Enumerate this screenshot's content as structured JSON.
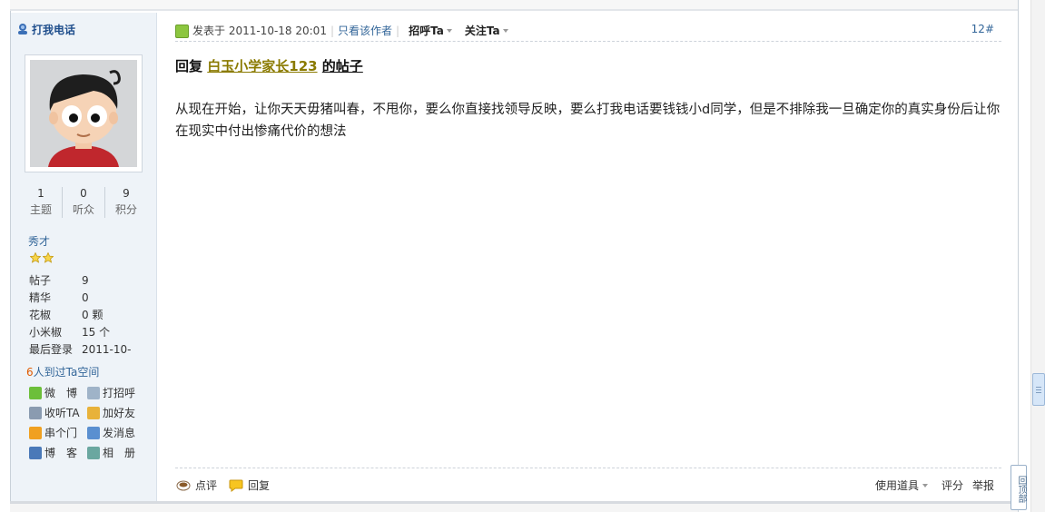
{
  "sidebar": {
    "call_me": "打我电话",
    "stats": [
      {
        "value": "1",
        "label": "主题"
      },
      {
        "value": "0",
        "label": "听众"
      },
      {
        "value": "9",
        "label": "积分"
      }
    ],
    "rank": "秀才",
    "star_count": 2,
    "info": [
      {
        "key": "帖子",
        "value": "9"
      },
      {
        "key": "精华",
        "value": "0"
      },
      {
        "key": "花椒",
        "value": "0 颗"
      },
      {
        "key": "小米椒",
        "value": "15 个"
      },
      {
        "key": "最后登录",
        "value": "2011-10-"
      }
    ],
    "visitors_count": "6",
    "visitors_text": "人到过Ta空间",
    "actions": [
      {
        "label": "微　博",
        "icon": "weibo-icon"
      },
      {
        "label": "打招呼",
        "icon": "greet-icon"
      },
      {
        "label": "收听TA",
        "icon": "follow-icon"
      },
      {
        "label": "加好友",
        "icon": "add-friend-icon"
      },
      {
        "label": "串个门",
        "icon": "home-icon"
      },
      {
        "label": "发消息",
        "icon": "message-icon"
      },
      {
        "label": "博　客",
        "icon": "blog-icon"
      },
      {
        "label": "相　册",
        "icon": "album-icon"
      }
    ]
  },
  "post": {
    "posted_label": "发表于 2011-10-18 20:01",
    "author_only": "只看该作者",
    "greet_dropdown": "招呼Ta",
    "follow_dropdown": "关注Ta",
    "floor": "12#",
    "reply_prefix": "回复",
    "quoted_user": "白玉小学家长123",
    "reply_suffix": "的帖子",
    "body": "从现在开始，让你天天毋猪叫春，不甩你，要么你直接找领导反映，要么打我电话要钱钱小d同学，但是不排除我一旦确定你的真实身份后让你在现实中付出惨痛代价的想法"
  },
  "footer": {
    "comment": "点评",
    "reply": "回复",
    "use_tool": "使用道具",
    "rate": "评分",
    "report": "举报"
  },
  "back_to_top": "回顶部",
  "colors": {
    "sidebar_bg": "#eef3f8",
    "link": "#336699",
    "quoted_user": "#8a7a00"
  }
}
